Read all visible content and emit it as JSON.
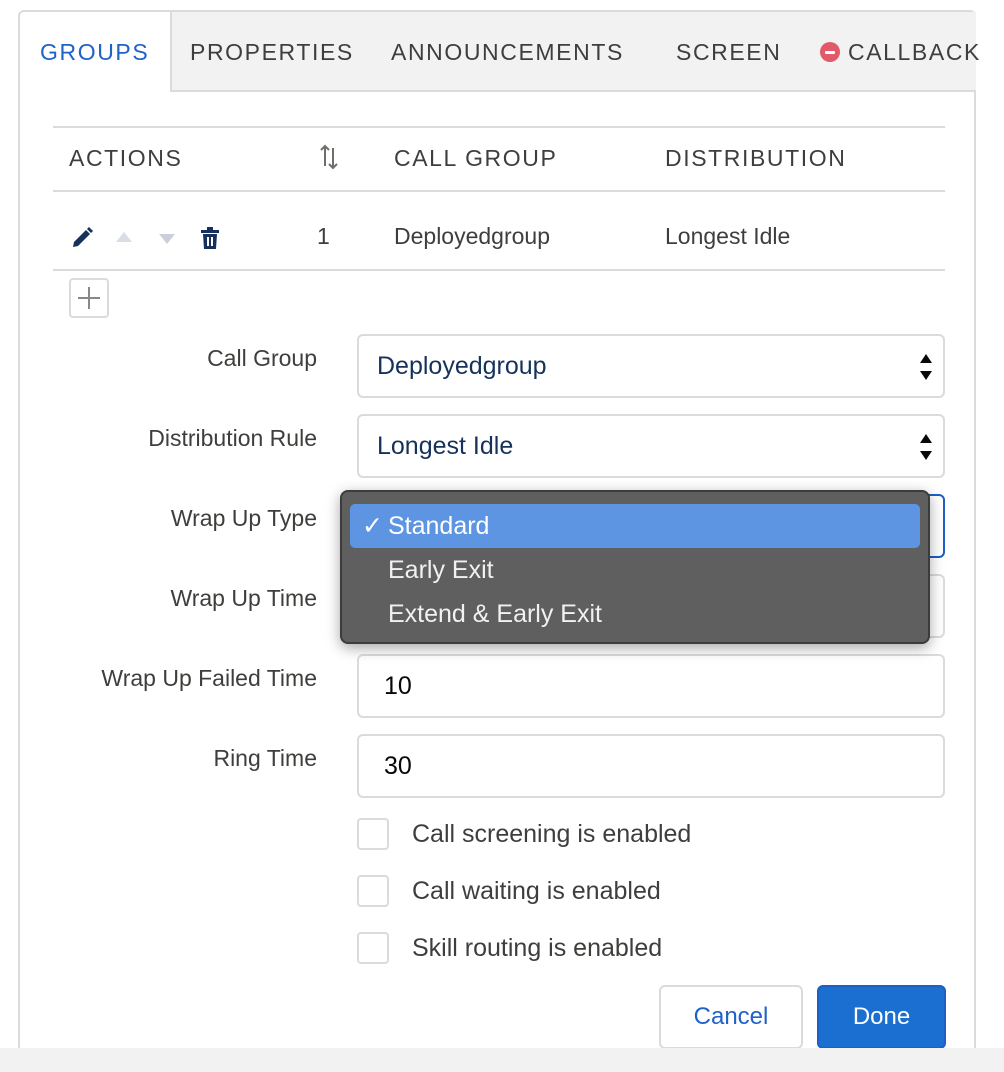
{
  "tabs": [
    {
      "label": "GROUPS"
    },
    {
      "label": "PROPERTIES"
    },
    {
      "label": "ANNOUNCEMENTS"
    },
    {
      "label": "SCREEN"
    },
    {
      "label": "CALLBACK"
    }
  ],
  "table": {
    "headers": {
      "actions": "ACTIONS",
      "call_group": "CALL GROUP",
      "distribution": "DISTRIBUTION"
    },
    "rows": [
      {
        "order": "1",
        "call_group": "Deployedgroup",
        "distribution": "Longest Idle"
      }
    ]
  },
  "form": {
    "call_group_label": "Call Group",
    "call_group_value": "Deployedgroup",
    "distribution_label": "Distribution Rule",
    "distribution_value": "Longest Idle",
    "wrap_up_type_label": "Wrap Up Type",
    "wrap_up_time_label": "Wrap Up Time",
    "wrap_up_failed_label": "Wrap Up Failed Time",
    "wrap_up_failed_value": "10",
    "ring_time_label": "Ring Time",
    "ring_time_value": "30"
  },
  "dropdown": {
    "check": "✓",
    "options": [
      {
        "label": "Standard",
        "selected": true
      },
      {
        "label": "Early Exit",
        "selected": false
      },
      {
        "label": "Extend & Early Exit",
        "selected": false
      }
    ]
  },
  "checkboxes": [
    {
      "label": "Call screening is enabled",
      "checked": false
    },
    {
      "label": "Call waiting is enabled",
      "checked": false
    },
    {
      "label": "Skill routing is enabled",
      "checked": false
    }
  ],
  "buttons": {
    "cancel": "Cancel",
    "done": "Done"
  },
  "colors": {
    "accent": "#1b6fd1",
    "tab_active": "#1f62c8",
    "danger": "#e05a69",
    "dropdown_bg": "#5f5f60",
    "dropdown_highlight": "#5d95e3"
  },
  "icons": [
    "pencil-icon",
    "arrow-up-icon",
    "arrow-down-icon",
    "trash-icon",
    "sort-icon",
    "plus-icon",
    "minus-circle-icon",
    "select-arrows-icon",
    "checkmark-icon"
  ]
}
